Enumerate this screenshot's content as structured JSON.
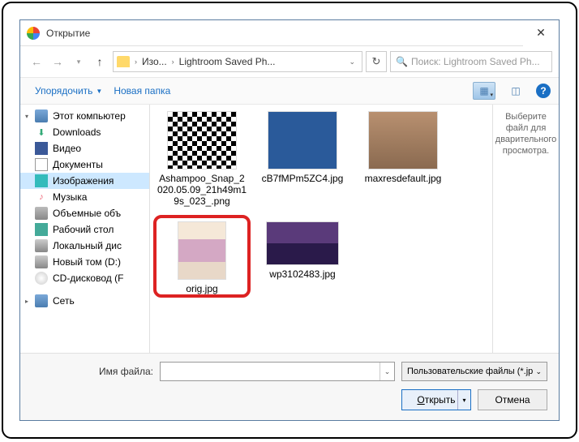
{
  "title": "Открытие",
  "nav": {
    "crumb1": "Изо...",
    "crumb2": "Lightroom Saved Ph...",
    "search_placeholder": "Поиск: Lightroom Saved Ph..."
  },
  "toolbar": {
    "organize": "Упорядочить",
    "new_folder": "Новая папка"
  },
  "sidebar": {
    "this_pc": "Этот компьютер",
    "downloads": "Downloads",
    "video": "Видео",
    "documents": "Документы",
    "images": "Изображения",
    "music": "Музыка",
    "volumes": "Объемные объ",
    "desktop": "Рабочий стол",
    "local_disk": "Локальный дис",
    "new_vol": "Новый том (D:)",
    "cd": "CD-дисковод (F",
    "network": "Сеть"
  },
  "files": {
    "f1": "Ashampoo_Snap_2020.05.09_21h49m19s_023_.png",
    "f2": "cB7fMPm5ZC4.jpg",
    "f3": "maxresdefault.jpg",
    "f4": "orig.jpg",
    "f5": "wp3102483.jpg"
  },
  "preview": "Выберите файл для дварительного просмотра.",
  "footer": {
    "filename_label": "Имя файла:",
    "filter": "Пользовательские файлы (*.jp",
    "open": "Открыть",
    "cancel": "Отмена"
  }
}
